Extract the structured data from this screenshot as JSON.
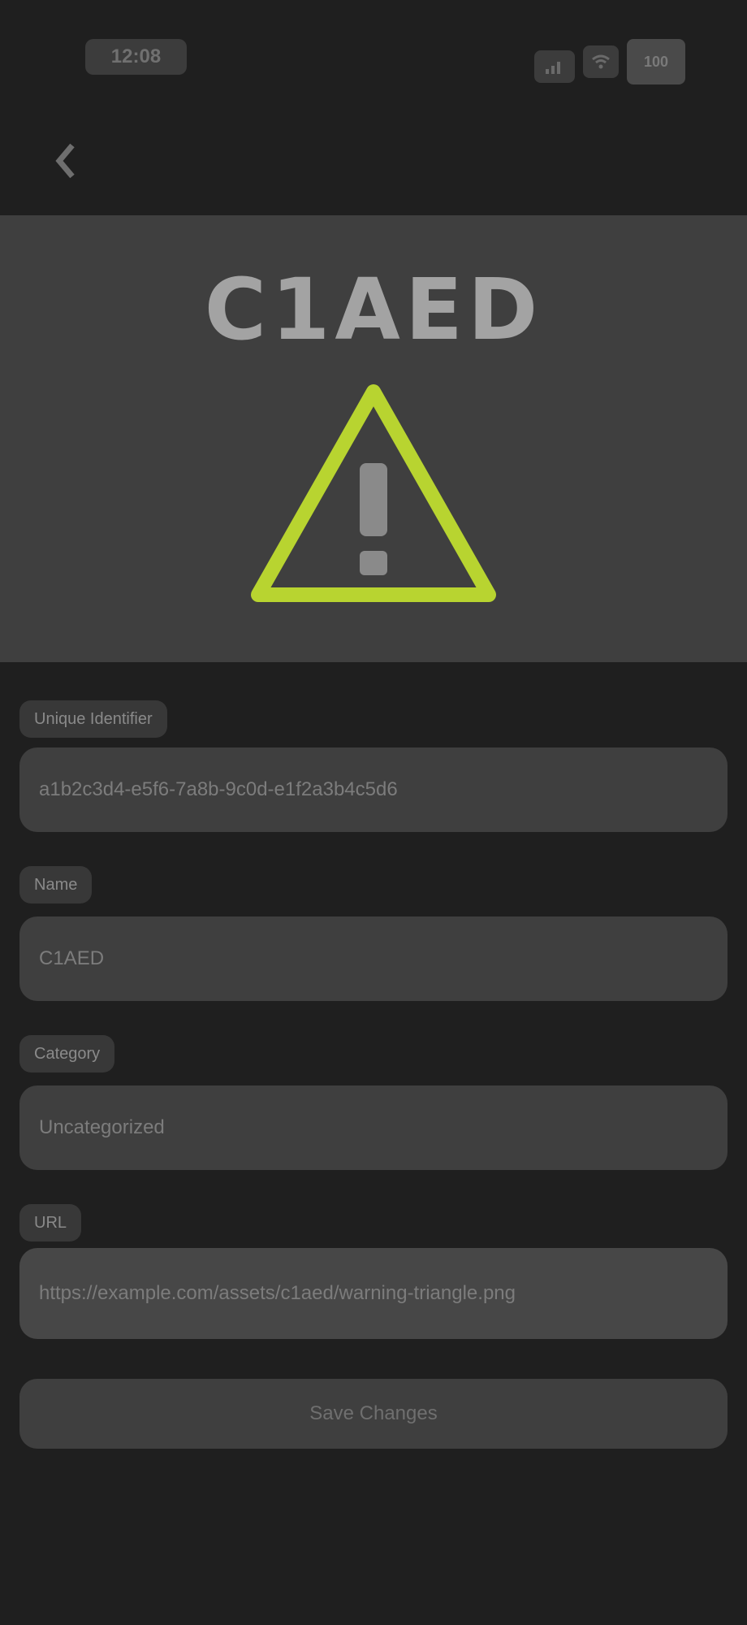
{
  "status_bar": {
    "time": "12:08",
    "signal_icon": "signal-icon",
    "wifi_icon": "wifi-icon",
    "battery_icon": "battery-icon",
    "battery": "100"
  },
  "app_bar": {
    "back_icon": "back-arrow-icon"
  },
  "hero": {
    "title": "C1AED",
    "icon": "warning-triangle-icon",
    "accent_color": "#b8d430"
  },
  "form": {
    "fields": [
      {
        "label": "Unique Identifier",
        "value": "a1b2c3d4-e5f6-7a8b-9c0d-e1f2a3b4c5d6"
      },
      {
        "label": "Name",
        "value": "C1AED"
      },
      {
        "label": "Category",
        "value": "Uncategorized"
      },
      {
        "label": "URL",
        "value": "https://example.com/assets/c1aed/warning-triangle.png"
      }
    ],
    "action_label": "Save Changes"
  }
}
